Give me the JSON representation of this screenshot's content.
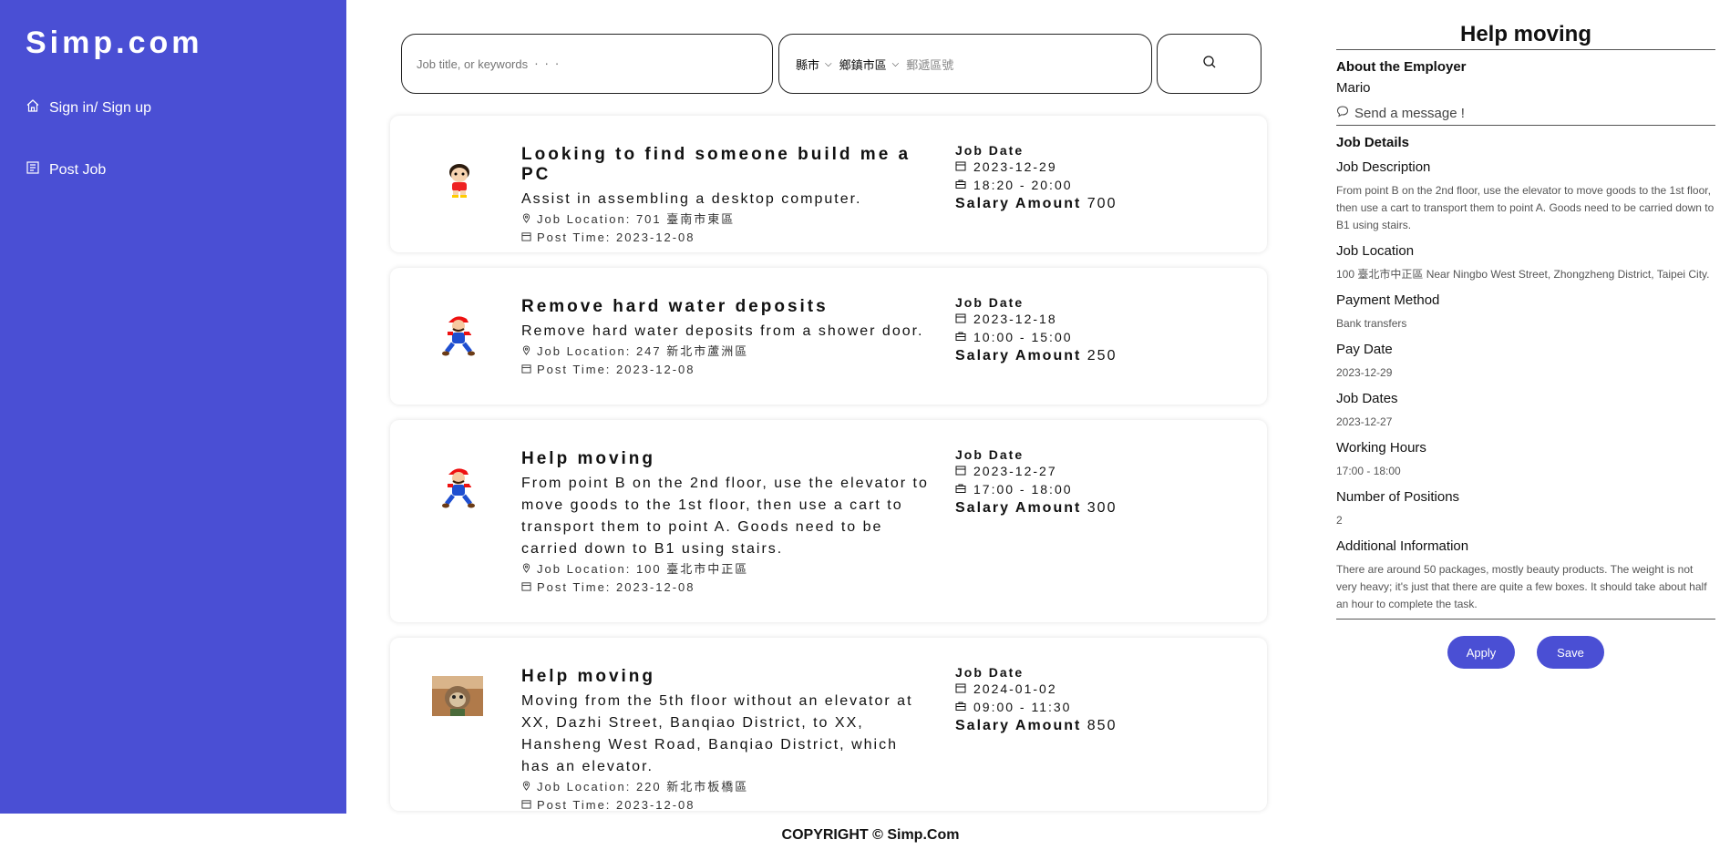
{
  "sidebar": {
    "brand": "Simp.com",
    "items": [
      {
        "label": "Sign in/ Sign up",
        "icon": "home-icon"
      },
      {
        "label": "Post Job",
        "icon": "document-icon"
      }
    ]
  },
  "search": {
    "keywords_placeholder": "Job title, or keywords  ‧  ‧  ‧",
    "county_label": "縣市",
    "district_label": "鄉鎮市區",
    "zip_placeholder": "郵遞區號",
    "search_icon": "search-icon"
  },
  "jobs": [
    {
      "title": "Looking to find someone build me a PC",
      "description": "Assist in assembling a desktop computer.",
      "location": "Job Location: 701 臺南市東區",
      "post_time": "Post Time: 2023-12-08",
      "date_label": "Job Date",
      "date": "2023-12-29",
      "hours": "18:20 - 20:00",
      "salary_label": "Salary Amount",
      "salary": "700",
      "avatar": "cartoon-boy-avatar"
    },
    {
      "title": "Remove hard water deposits",
      "description": "Remove hard water deposits from a shower door.",
      "location": "Job Location: 247 新北市蘆洲區",
      "post_time": "Post Time: 2023-12-08",
      "date_label": "Job Date",
      "date": "2023-12-18",
      "hours": "10:00 - 15:00",
      "salary_label": "Salary Amount",
      "salary": "250",
      "avatar": "plumber-avatar"
    },
    {
      "title": "Help moving",
      "description": "From point B on the 2nd floor, use the elevator to move goods to the 1st floor, then use a cart to transport them to point A. Goods need to be carried down to B1 using stairs.",
      "location": "Job Location: 100 臺北市中正區",
      "post_time": "Post Time: 2023-12-08",
      "date_label": "Job Date",
      "date": "2023-12-27",
      "hours": "17:00 - 18:00",
      "salary_label": "Salary Amount",
      "salary": "300",
      "avatar": "plumber-avatar"
    },
    {
      "title": "Help moving",
      "description": "Moving from the 5th floor without an elevator at XX, Dazhi Street, Banqiao District, to XX, Hansheng West Road, Banqiao District, which has an elevator.",
      "location": "Job Location: 220 新北市板橋區",
      "post_time": "Post Time: 2023-12-08",
      "date_label": "Job Date",
      "date": "2024-01-02",
      "hours": "09:00 - 11:30",
      "salary_label": "Salary Amount",
      "salary": "850",
      "avatar": "sloth-photo-avatar"
    }
  ],
  "detail": {
    "title": "Help moving",
    "employer_heading": "About the Employer",
    "employer_name": "Mario",
    "message_label": "Send a message !",
    "details_heading": "Job Details",
    "description_label": "Job Description",
    "description": "From point B on the 2nd floor, use the elevator to move goods to the 1st floor, then use a cart to transport them to point A. Goods need to be carried down to B1 using stairs.",
    "location_label": "Job Location",
    "location": "100 臺北市中正區 Near Ningbo West Street, Zhongzheng District, Taipei City.",
    "payment_label": "Payment Method",
    "payment": "Bank transfers",
    "pay_date_label": "Pay Date",
    "pay_date": "2023-12-29",
    "job_dates_label": "Job Dates",
    "job_dates": "2023-12-27",
    "hours_label": "Working Hours",
    "hours": "17:00 - 18:00",
    "positions_label": "Number of Positions",
    "positions": "2",
    "additional_label": "Additional Information",
    "additional": "There are around 50 packages, mostly beauty products. The weight is not very heavy; it's just that there are quite a few boxes. It should take about half an hour to complete the task.",
    "apply_label": "Apply",
    "save_label": "Save"
  },
  "footer": {
    "copyright": "COPYRIGHT © Simp.Com"
  },
  "colors": {
    "accent": "#4a4fd4",
    "background": "#ffffff"
  }
}
